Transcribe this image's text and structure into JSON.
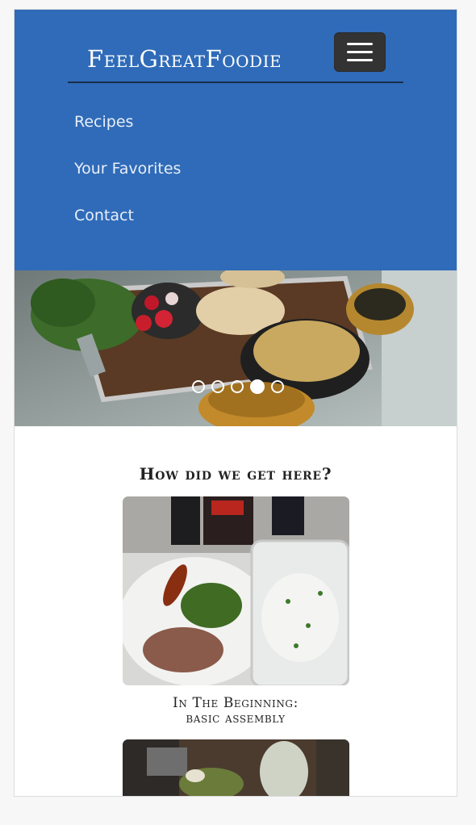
{
  "brand": {
    "name": "FeelGreatFoodie"
  },
  "nav": {
    "menu_icon": "hamburger-menu-icon",
    "links": [
      {
        "label": "Recipes"
      },
      {
        "label": "Your Favorites"
      },
      {
        "label": "Contact"
      }
    ]
  },
  "carousel": {
    "slide_count": 5,
    "active_index": 3
  },
  "section": {
    "title": "How did we get here?",
    "cards": [
      {
        "title_line1": "In The Beginning:",
        "title_line2": "basic assembly"
      }
    ]
  },
  "colors": {
    "navbar": "#2f6bb8",
    "menu_button": "#333333",
    "background": "#ffffff"
  }
}
